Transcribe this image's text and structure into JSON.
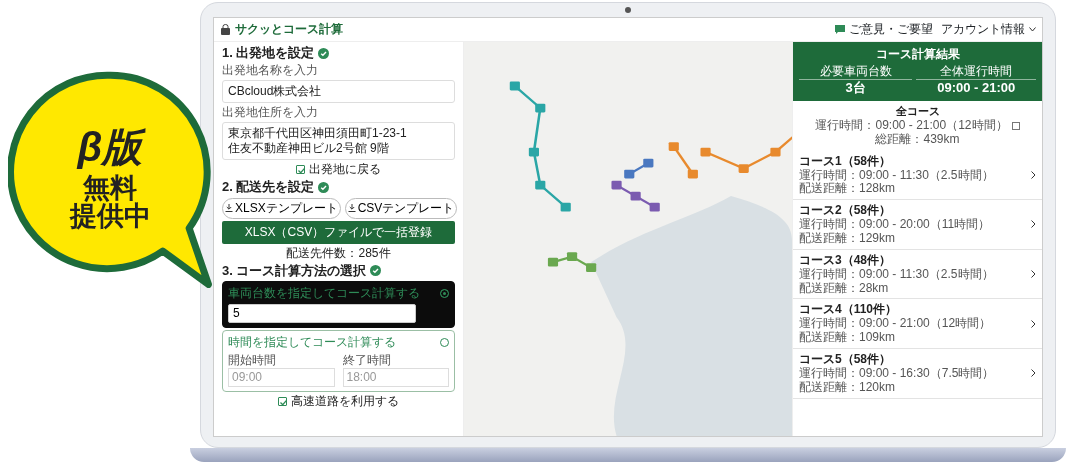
{
  "promo": {
    "lines": [
      "β版",
      "無料",
      "提供中"
    ]
  },
  "header": {
    "logo": "サクッとコース計算",
    "feedback": "ご意見・ご要望",
    "account": "アカウント情報"
  },
  "step1": {
    "title": "1. 出発地を設定",
    "done": true,
    "name_label": "出発地名称を入力",
    "name_value": "CBcloud株式会社",
    "address_label": "出発地住所を入力",
    "address_lines": [
      "東京都千代田区神田須田町1-23-1",
      "住友不動産神田ビル2号館 9階"
    ],
    "return": {
      "label": "出発地に戻る",
      "checked": true
    }
  },
  "step2": {
    "title": "2. 配送先を設定",
    "done": true,
    "templates": [
      "XLSXテンプレート",
      "CSVテンプレート"
    ],
    "upload": "XLSX（CSV）ファイルで一括登録",
    "count": "配送先件数：285件"
  },
  "step3": {
    "title": "3. コース計算方法の選択",
    "done": true,
    "options": [
      {
        "kind": "count",
        "label": "車両台数を指定してコース計算する",
        "selected": true,
        "value": "5"
      },
      {
        "kind": "time",
        "label": "時間を指定してコース計算する",
        "selected": false,
        "fields": [
          {
            "label": "開始時間",
            "placeholder": "09:00"
          },
          {
            "label": "終了時間",
            "placeholder": "18:00"
          }
        ]
      }
    ],
    "highway": {
      "label": "高速道路を利用する",
      "checked": true
    }
  },
  "result": {
    "title": "コース計算結果",
    "stats": [
      {
        "label": "必要車両台数",
        "value": "3台"
      },
      {
        "label": "全体運行時間",
        "value": "09:00 - 21:00"
      }
    ]
  },
  "all": {
    "title": "全コース",
    "time": "運行時間：09:00 - 21:00（12時間）",
    "distance": "総距離：439km"
  },
  "courses": [
    {
      "title": "コース1（58件）",
      "time": "運行時間：09:00 - 11:30（2.5時間）",
      "distance": "配送距離：128km"
    },
    {
      "title": "コース2（58件）",
      "time": "運行時間：09:00 - 20:00（11時間）",
      "distance": "配送距離：129km"
    },
    {
      "title": "コース3（48件）",
      "time": "運行時間：09:00 - 11:30（2.5時間）",
      "distance": "配送距離：28km"
    },
    {
      "title": "コース4（110件）",
      "time": "運行時間：09:00 - 21:00（12時間）",
      "distance": "配送距離：109km"
    },
    {
      "title": "コース5（58件）",
      "time": "運行時間：09:00 - 16:30（7.5時間）",
      "distance": "配送距離：120km"
    }
  ]
}
